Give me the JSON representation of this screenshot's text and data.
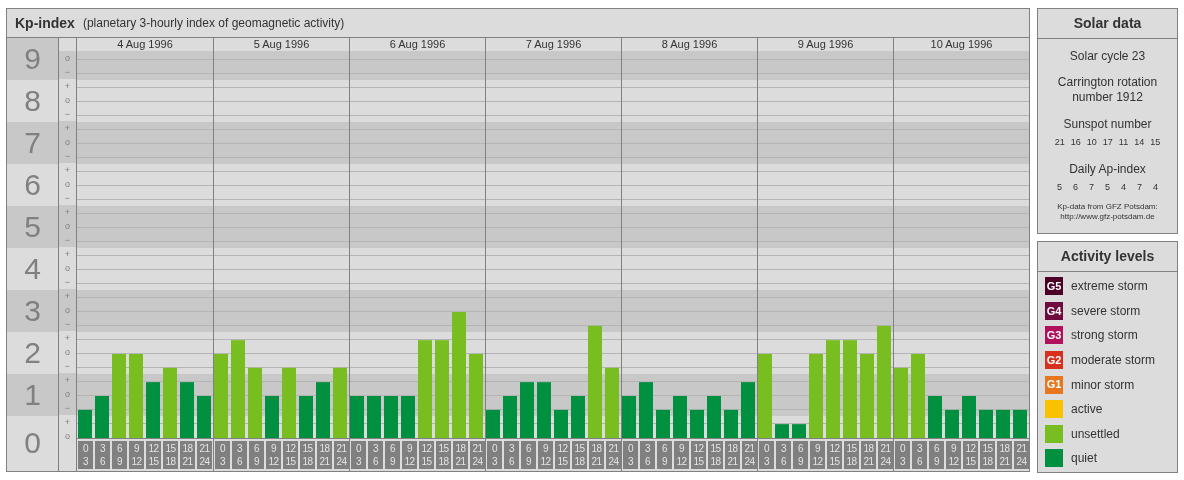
{
  "title": {
    "name": "Kp-index",
    "subtitle": "(planetary 3-hourly index of geomagnetic activity)"
  },
  "axis": {
    "minor_marks": [
      "o",
      "−",
      "+",
      "o",
      "−",
      "+",
      "o",
      "−",
      "+",
      "o",
      "−",
      "+",
      "o",
      "−",
      "+",
      "o",
      "−",
      "+",
      "o",
      "−",
      "+",
      "o",
      "−",
      "+",
      "o",
      "−",
      "+",
      "o"
    ]
  },
  "days": [
    {
      "date": "4 Aug 1996",
      "slots": [
        [
          "0",
          "3"
        ],
        [
          "3",
          "6"
        ],
        [
          "6",
          "9"
        ],
        [
          "9",
          "12"
        ],
        [
          "12",
          "15"
        ],
        [
          "15",
          "18"
        ],
        [
          "18",
          "21"
        ],
        [
          "21",
          "24"
        ]
      ]
    },
    {
      "date": "5 Aug 1996",
      "slots": [
        [
          "0",
          "3"
        ],
        [
          "3",
          "6"
        ],
        [
          "6",
          "9"
        ],
        [
          "9",
          "12"
        ],
        [
          "12",
          "15"
        ],
        [
          "15",
          "18"
        ],
        [
          "18",
          "21"
        ],
        [
          "21",
          "24"
        ]
      ]
    },
    {
      "date": "6 Aug 1996",
      "slots": [
        [
          "0",
          "3"
        ],
        [
          "3",
          "6"
        ],
        [
          "6",
          "9"
        ],
        [
          "9",
          "12"
        ],
        [
          "12",
          "15"
        ],
        [
          "15",
          "18"
        ],
        [
          "18",
          "21"
        ],
        [
          "21",
          "24"
        ]
      ]
    },
    {
      "date": "7 Aug 1996",
      "slots": [
        [
          "0",
          "3"
        ],
        [
          "3",
          "6"
        ],
        [
          "6",
          "9"
        ],
        [
          "9",
          "12"
        ],
        [
          "12",
          "15"
        ],
        [
          "15",
          "18"
        ],
        [
          "18",
          "21"
        ],
        [
          "21",
          "24"
        ]
      ]
    },
    {
      "date": "8 Aug 1996",
      "slots": [
        [
          "0",
          "3"
        ],
        [
          "3",
          "6"
        ],
        [
          "6",
          "9"
        ],
        [
          "9",
          "12"
        ],
        [
          "12",
          "15"
        ],
        [
          "15",
          "18"
        ],
        [
          "18",
          "21"
        ],
        [
          "21",
          "24"
        ]
      ]
    },
    {
      "date": "9 Aug 1996",
      "slots": [
        [
          "0",
          "3"
        ],
        [
          "3",
          "6"
        ],
        [
          "6",
          "9"
        ],
        [
          "9",
          "12"
        ],
        [
          "12",
          "15"
        ],
        [
          "15",
          "18"
        ],
        [
          "18",
          "21"
        ],
        [
          "21",
          "24"
        ]
      ]
    },
    {
      "date": "10 Aug 1996",
      "slots": [
        [
          "0",
          "3"
        ],
        [
          "3",
          "6"
        ],
        [
          "6",
          "9"
        ],
        [
          "9",
          "12"
        ],
        [
          "12",
          "15"
        ],
        [
          "15",
          "18"
        ],
        [
          "18",
          "21"
        ],
        [
          "21",
          "24"
        ]
      ]
    }
  ],
  "chart_data": {
    "type": "bar",
    "categories": [
      null,
      null,
      null,
      null,
      null,
      null,
      null,
      null,
      null,
      null,
      null,
      null,
      null,
      null,
      null,
      null,
      null,
      null,
      null,
      null,
      null,
      null,
      null,
      null,
      null,
      null,
      null,
      null,
      null,
      null,
      null,
      null,
      null,
      null,
      null,
      null,
      null,
      null,
      null,
      null,
      null,
      null,
      null,
      null,
      null,
      null,
      null,
      null,
      null,
      null,
      null,
      null,
      null,
      null,
      null,
      null
    ],
    "ylim": [
      0,
      9.5
    ],
    "grid": true,
    "yticks": [
      {
        "value": 9,
        "label": "9"
      },
      {
        "value": 8,
        "label": "8"
      },
      {
        "value": 7,
        "label": "7"
      },
      {
        "value": 6,
        "label": "6"
      },
      {
        "value": 5,
        "label": "5"
      },
      {
        "value": 4,
        "label": "4"
      },
      {
        "value": 3,
        "label": "3"
      },
      {
        "value": 2,
        "label": "2"
      },
      {
        "value": 1,
        "label": "1"
      },
      {
        "value": 0,
        "label": "0"
      }
    ],
    "series": [
      {
        "values": [
          0.67,
          1,
          2,
          2,
          1.33,
          1.67,
          1.33,
          1,
          2,
          2.33,
          1.67,
          1,
          1.67,
          1,
          1.33,
          1.67,
          1,
          1,
          1,
          1,
          2.33,
          2.33,
          3,
          2,
          0.67,
          1,
          1.33,
          1.33,
          0.67,
          1,
          2.67,
          1.67,
          1,
          1.33,
          0.67,
          1,
          0.67,
          1,
          0.67,
          1.33,
          2,
          0.33,
          0.33,
          2,
          2.33,
          2.33,
          2,
          2.67,
          1.67,
          2,
          1,
          0.67,
          1,
          0.67,
          0.67,
          0.67
        ]
      }
    ]
  },
  "solar_data": {
    "title": "Solar data",
    "cycle": "Solar cycle 23",
    "carrington": [
      "Carrington rotation",
      "number 1912"
    ],
    "sunspot_title": "Sunspot number",
    "sunspot_numbers": [
      "21",
      "16",
      "10",
      "17",
      "11",
      "14",
      "15"
    ],
    "ap_title": "Daily Ap-index",
    "ap_values": [
      "5",
      "6",
      "7",
      "5",
      "4",
      "7",
      "4"
    ],
    "credit": [
      "Kp-data from GFZ Potsdam:",
      "http://www.gfz-potsdam.de"
    ]
  },
  "activity_levels": {
    "title": "Activity levels",
    "items": [
      {
        "kind": "g5",
        "badge": "G5",
        "label": "extreme storm",
        "color": "#4d0025"
      },
      {
        "kind": "g4",
        "badge": "G4",
        "label": "severe storm",
        "color": "#6e0a3e"
      },
      {
        "kind": "g3",
        "badge": "G3",
        "label": "strong storm",
        "color": "#b0105c"
      },
      {
        "kind": "g2",
        "badge": "G2",
        "label": "moderate storm",
        "color": "#d8301e"
      },
      {
        "kind": "g1",
        "badge": "G1",
        "label": "minor storm",
        "color": "#e8761e"
      },
      {
        "kind": "active",
        "label": "active",
        "color": "#f8c200"
      },
      {
        "kind": "unsettled",
        "label": "unsettled",
        "color": "#78be20"
      },
      {
        "kind": "quiet",
        "label": "quiet",
        "color": "#009040"
      }
    ]
  }
}
